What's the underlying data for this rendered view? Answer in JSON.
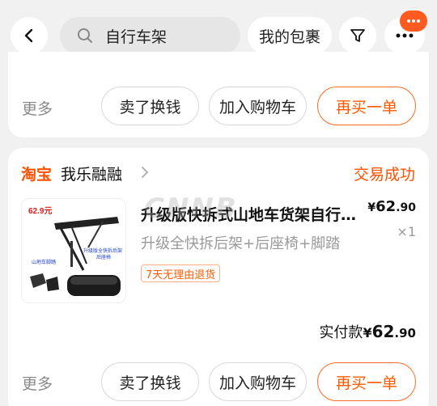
{
  "topbar": {
    "search": {
      "value": "自行车架",
      "icon": "search-icon"
    },
    "bag_label": "我的包裹",
    "filter_icon": "filter-icon",
    "more_icon": "more-icon",
    "notif_icon": "message-icon"
  },
  "order1": {
    "cutoff_text": "…",
    "more_label": "更多",
    "actions": [
      "卖了换钱",
      "加入购物车",
      "再买一单"
    ]
  },
  "order2": {
    "shop": {
      "platform": "淘宝",
      "name": "我乐融融"
    },
    "status": "交易成功",
    "product": {
      "title": "升级版快拆式山地车货架自行车后货架",
      "spec": "升级全快拆后架+后座椅+脚踏",
      "price_currency": "¥",
      "price_int": "62",
      "price_dec": ".90",
      "qty": "×1",
      "tag": "7天无理由退货",
      "thumb": {
        "price_label": "62.9元",
        "caption1": "山地车脚踏",
        "caption2": "升级版全快拆后架",
        "caption3": "后座椅"
      }
    },
    "paid": {
      "label": "实付款",
      "currency": "¥",
      "amount_int": "62",
      "amount_dec": ".90"
    },
    "more_label": "更多",
    "actions": [
      "卖了换钱",
      "加入购物车",
      "再买一单"
    ]
  },
  "watermark": "CNNB",
  "colors": {
    "accent": "#ff5000",
    "background": "#f1f1f1",
    "card": "#ffffff"
  }
}
